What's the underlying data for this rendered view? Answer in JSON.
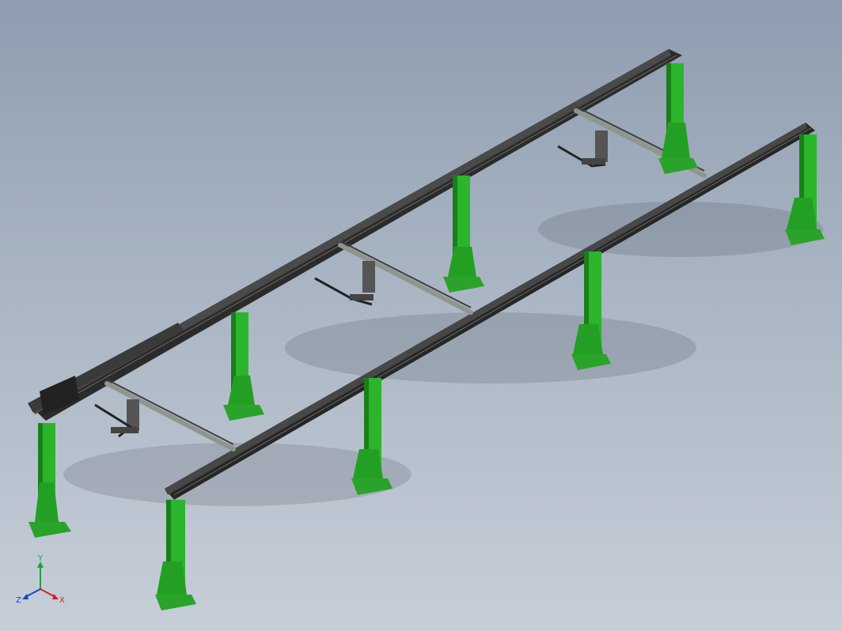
{
  "viewport": {
    "background_top": "#8e9db0",
    "background_bottom": "#c6ced8"
  },
  "model": {
    "column_color": "#2bb52b",
    "column_shade": "#1a7f1a",
    "rail_color": "#2a2a2a",
    "beam_color": "#8a8f8a"
  },
  "triad": {
    "x_label": "X",
    "y_label": "Y",
    "z_label": "Z",
    "x_color": "#d42020",
    "y_color": "#20a040",
    "z_color": "#2040d0"
  }
}
